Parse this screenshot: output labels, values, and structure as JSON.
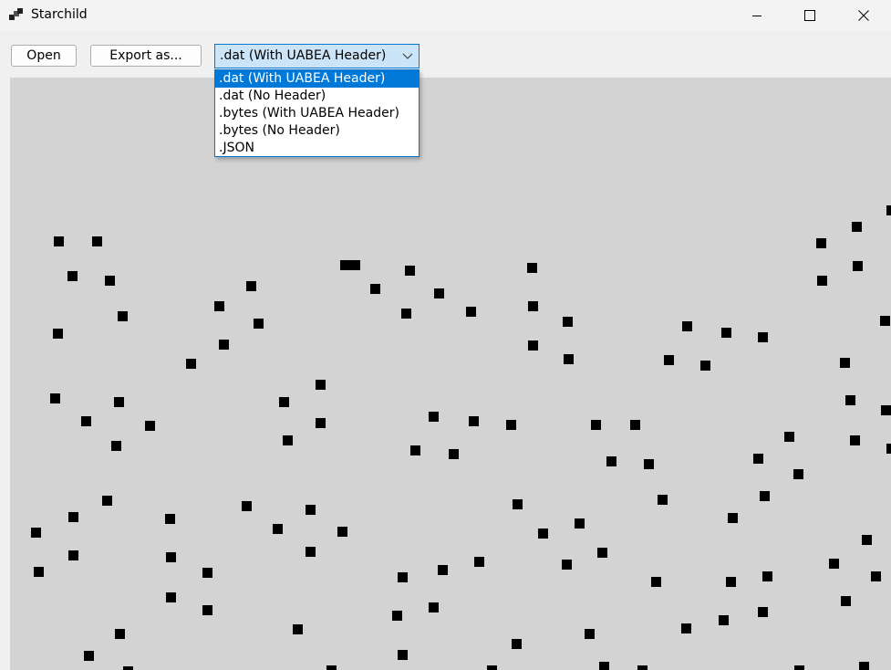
{
  "window": {
    "title": "Starchild",
    "controls": [
      "minimize-icon",
      "maximize-icon",
      "close-icon"
    ]
  },
  "toolbar": {
    "open_label": "Open",
    "export_label": "Export as...",
    "format_value": ".dat (With UABEA Header)"
  },
  "format_options": [
    ".dat (With UABEA Header)",
    ".dat (No Header)",
    ".bytes (With UABEA Header)",
    ".bytes (No Header)",
    ".JSON"
  ],
  "selected_option_index": 0,
  "colors": {
    "canvas_background": "#d3d3d3",
    "marker": "#000000",
    "accent": "#0078d7"
  }
}
